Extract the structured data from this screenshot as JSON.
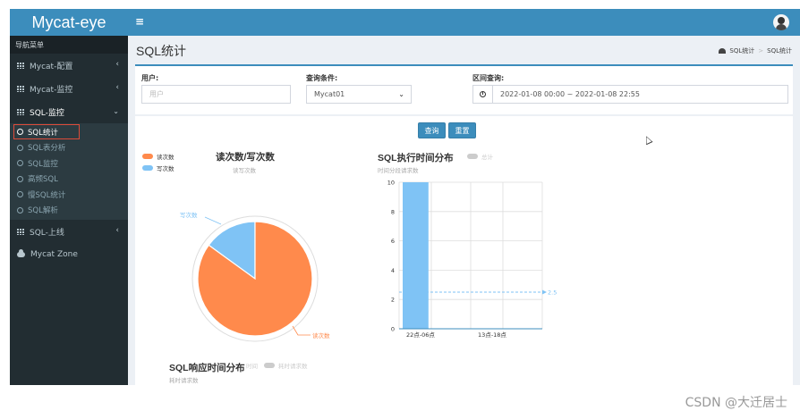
{
  "app": {
    "title": "Mycat-eye"
  },
  "sidebar": {
    "header": "导航菜单",
    "items": [
      {
        "label": "Mycat-配置"
      },
      {
        "label": "Mycat-监控"
      },
      {
        "label": "SQL-监控"
      },
      {
        "label": "SQL-上线"
      },
      {
        "label": "Mycat Zone"
      }
    ],
    "submenu": [
      {
        "label": "SQL统计",
        "active": true
      },
      {
        "label": "SQL表分析"
      },
      {
        "label": "SQL监控"
      },
      {
        "label": "高频SQL"
      },
      {
        "label": "慢SQL统计"
      },
      {
        "label": "SQL解析"
      }
    ]
  },
  "page": {
    "title": "SQL统计",
    "breadcrumb": [
      "SQL统计",
      ">",
      "SQL统计"
    ]
  },
  "filters": {
    "user_label": "用户:",
    "user_placeholder": "用户",
    "condition_label": "查询条件:",
    "condition_value": "Mycat01",
    "range_label": "区间查询:",
    "range_value": "2022-01-08 00:00 ~ 2022-01-08 22:55"
  },
  "buttons": {
    "query": "查询",
    "reset": "重置"
  },
  "charts": {
    "rw": {
      "title": "读次数/写次数",
      "subtitle": "读写次数",
      "legend": [
        "读次数",
        "写次数"
      ],
      "labels": [
        "写次数",
        "读次数"
      ]
    },
    "exec": {
      "title": "SQL执行时间分布",
      "subtitle": "时间分段请求数",
      "legend": [
        "总计"
      ],
      "mark_label": "2.5"
    },
    "resp": {
      "title": "SQL响应时间分布",
      "subtitle": "耗时请求数",
      "legend": [
        "时间",
        "耗时请求数"
      ]
    }
  },
  "colors": {
    "read": "#ff8a4c",
    "write": "#7fc3f5",
    "accent": "#3c8dbc"
  },
  "chart_data": [
    {
      "type": "pie",
      "title": "读次数/写次数",
      "categories": [
        "读次数",
        "写次数"
      ],
      "values": [
        85,
        15
      ]
    },
    {
      "type": "bar",
      "title": "SQL执行时间分布",
      "categories": [
        "22点-06点",
        "13点-18点"
      ],
      "series": [
        {
          "name": "总计",
          "values": [
            10,
            0
          ]
        }
      ],
      "ylim": [
        0,
        10
      ],
      "yticks": [
        "0",
        "2",
        "4",
        "6",
        "8",
        "10"
      ],
      "average_line": 2.5
    }
  ],
  "watermark": "CSDN @大迁居士"
}
